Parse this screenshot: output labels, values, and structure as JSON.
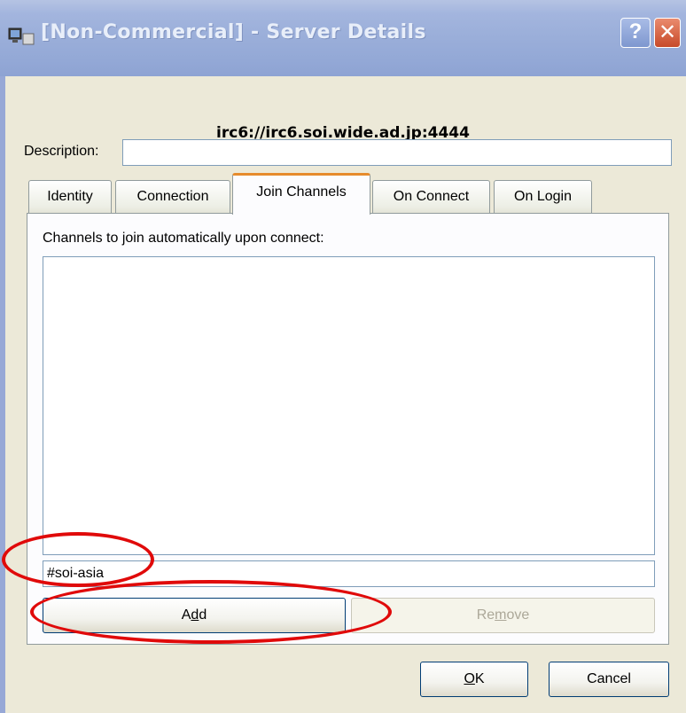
{
  "window": {
    "title": "[Non-Commercial] - Server Details",
    "help_glyph": "?",
    "close_glyph": "✕",
    "server_url": "irc6://irc6.soi.wide.ad.jp:4444"
  },
  "description": {
    "label": "Description:",
    "value": ""
  },
  "tabs": [
    {
      "label": "Identity",
      "active": false
    },
    {
      "label": "Connection",
      "active": false
    },
    {
      "label": "Join Channels",
      "active": true
    },
    {
      "label": "On Connect",
      "active": false
    },
    {
      "label": "On Login",
      "active": false
    }
  ],
  "join_channels": {
    "hint": "Channels to join automatically upon connect:",
    "channels": [],
    "input_value": "#soi-asia",
    "add_label": {
      "pre": "A",
      "accel": "d",
      "post": "d"
    },
    "remove_label": {
      "pre": "Re",
      "accel": "m",
      "post": "ove"
    }
  },
  "footer": {
    "ok_label": {
      "pre": "",
      "accel": "O",
      "post": "K"
    },
    "cancel_label": "Cancel"
  },
  "annotation_color": "#e00a0a",
  "tab_accent_color": "#e68b2c"
}
